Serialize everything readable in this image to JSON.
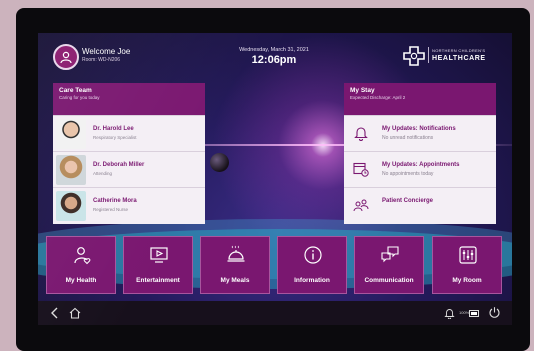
{
  "header": {
    "welcome": "Welcome Joe",
    "room": "Room: WD-N206",
    "date": "Wednesday, March 31, 2021",
    "time": "12:06pm",
    "brand_small": "NORTHERN CHILDREN'S",
    "brand_big": "HEALTHCARE"
  },
  "care_team": {
    "title": "Care Team",
    "subtitle": "Caring for you today",
    "members": [
      {
        "name": "Dr. Harold Lee",
        "role": "Respiratory Specialist"
      },
      {
        "name": "Dr. Deborah Miller",
        "role": "Attending"
      },
      {
        "name": "Catherine Mora",
        "role": "Registered Nurse"
      }
    ]
  },
  "my_stay": {
    "title": "My Stay",
    "subtitle": "Expected Discharge: April 2",
    "items": [
      {
        "title": "My Updates: Notifications",
        "subtitle": "No unread notifications",
        "icon": "bell-icon"
      },
      {
        "title": "My Updates: Appointments",
        "subtitle": "No appointments today",
        "icon": "calendar-clock-icon"
      },
      {
        "title": "Patient Concierge",
        "subtitle": "",
        "icon": "concierge-people-icon"
      }
    ]
  },
  "tiles": [
    {
      "label": "My Health",
      "icon": "person-heart-icon"
    },
    {
      "label": "Entertainment",
      "icon": "play-screen-icon"
    },
    {
      "label": "My Meals",
      "icon": "meal-cloche-icon"
    },
    {
      "label": "Information",
      "icon": "info-icon"
    },
    {
      "label": "Communication",
      "icon": "chat-bubbles-icon"
    },
    {
      "label": "My Room",
      "icon": "room-controls-icon"
    }
  ],
  "navbar": {
    "battery": "100%"
  },
  "colors": {
    "accent": "#7a1770",
    "panel_bg": "#f4eff5",
    "navbar_bg": "#17101c"
  }
}
